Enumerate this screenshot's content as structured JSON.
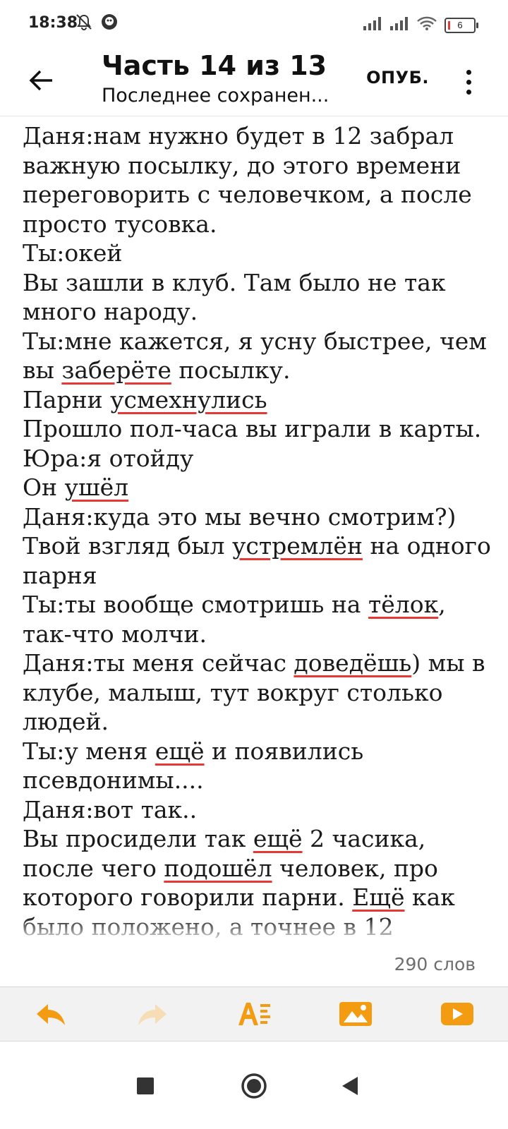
{
  "status_bar": {
    "time": "18:38",
    "battery_level": "6",
    "icons": [
      "mute-alarm-icon",
      "app-notification-icon",
      "signal-icon",
      "signal-icon",
      "wifi-icon",
      "battery-icon"
    ]
  },
  "app_bar": {
    "title": "Часть 14 из 13",
    "subtitle": "Последнее сохранен...",
    "publish_label": "ОПУБ.",
    "back_icon": "arrow-left-icon",
    "more_icon": "more-vert-icon"
  },
  "editor": {
    "lines": [
      [
        {
          "t": "Даня:нам нужно будет в 12 забрал важную посылку, до этого времени переговорить с человечком, а после просто тусовка."
        }
      ],
      [
        {
          "t": "Ты:окей"
        }
      ],
      [
        {
          "t": "Вы зашли в клуб. Там было не так много народу."
        }
      ],
      [
        {
          "t": "Ты:мне кажется, я усну быстрее, чем вы "
        },
        {
          "t": "заберёте",
          "sp": true
        },
        {
          "t": " посылку."
        }
      ],
      [
        {
          "t": "Парни "
        },
        {
          "t": "усмехнулись",
          "sp": true
        }
      ],
      [
        {
          "t": "Прошло пол-часа вы играли в карты."
        }
      ],
      [
        {
          "t": "Юра:я отойду"
        }
      ],
      [
        {
          "t": "Он "
        },
        {
          "t": "ушёл",
          "sp": true
        }
      ],
      [
        {
          "t": "Даня:куда это мы вечно смотрим?)"
        }
      ],
      [
        {
          "t": "Твой взгляд был "
        },
        {
          "t": "устремлён",
          "sp": true
        },
        {
          "t": " на одного парня"
        }
      ],
      [
        {
          "t": "Ты:ты вообще смотришь на "
        },
        {
          "t": "тёлок",
          "sp": true
        },
        {
          "t": ", так-что молчи."
        }
      ],
      [
        {
          "t": "Даня:ты меня сейчас "
        },
        {
          "t": "доведёшь",
          "sp": true
        },
        {
          "t": ") мы в клубе, малыш, тут вокруг столько людей."
        }
      ],
      [
        {
          "t": "Ты:у меня "
        },
        {
          "t": "ещё",
          "sp": true
        },
        {
          "t": " и  появились псевдонимы...."
        }
      ],
      [
        {
          "t": "Даня:вот так.."
        }
      ],
      [
        {
          "t": "Вы просидели так "
        },
        {
          "t": "ещё",
          "sp": true
        },
        {
          "t": " 2 часика, после чего "
        },
        {
          "t": "подошёл",
          "sp": true
        },
        {
          "t": " человек, про которого говорили парни. "
        },
        {
          "t": "Ещё",
          "sp": true
        },
        {
          "t": " как было положено, а точнее в 12 "
        }
      ]
    ]
  },
  "word_count": "290 слов",
  "toolbar": {
    "items": [
      {
        "name": "undo-icon",
        "color": "#f39c12",
        "enabled": true
      },
      {
        "name": "redo-icon",
        "color": "#f6ddb5",
        "enabled": false
      },
      {
        "name": "text-format-icon",
        "color": "#f39c12",
        "enabled": true
      },
      {
        "name": "insert-image-icon",
        "color": "#f39c12",
        "enabled": true
      },
      {
        "name": "insert-video-icon",
        "color": "#f39c12",
        "enabled": true
      }
    ]
  },
  "nav_bar": {
    "items": [
      "recent-apps-icon",
      "home-icon",
      "back-icon"
    ]
  },
  "colors": {
    "accent": "#f39c12",
    "spellcheck_underline": "#e53935",
    "toolbar_bg": "#f2f2f2"
  }
}
